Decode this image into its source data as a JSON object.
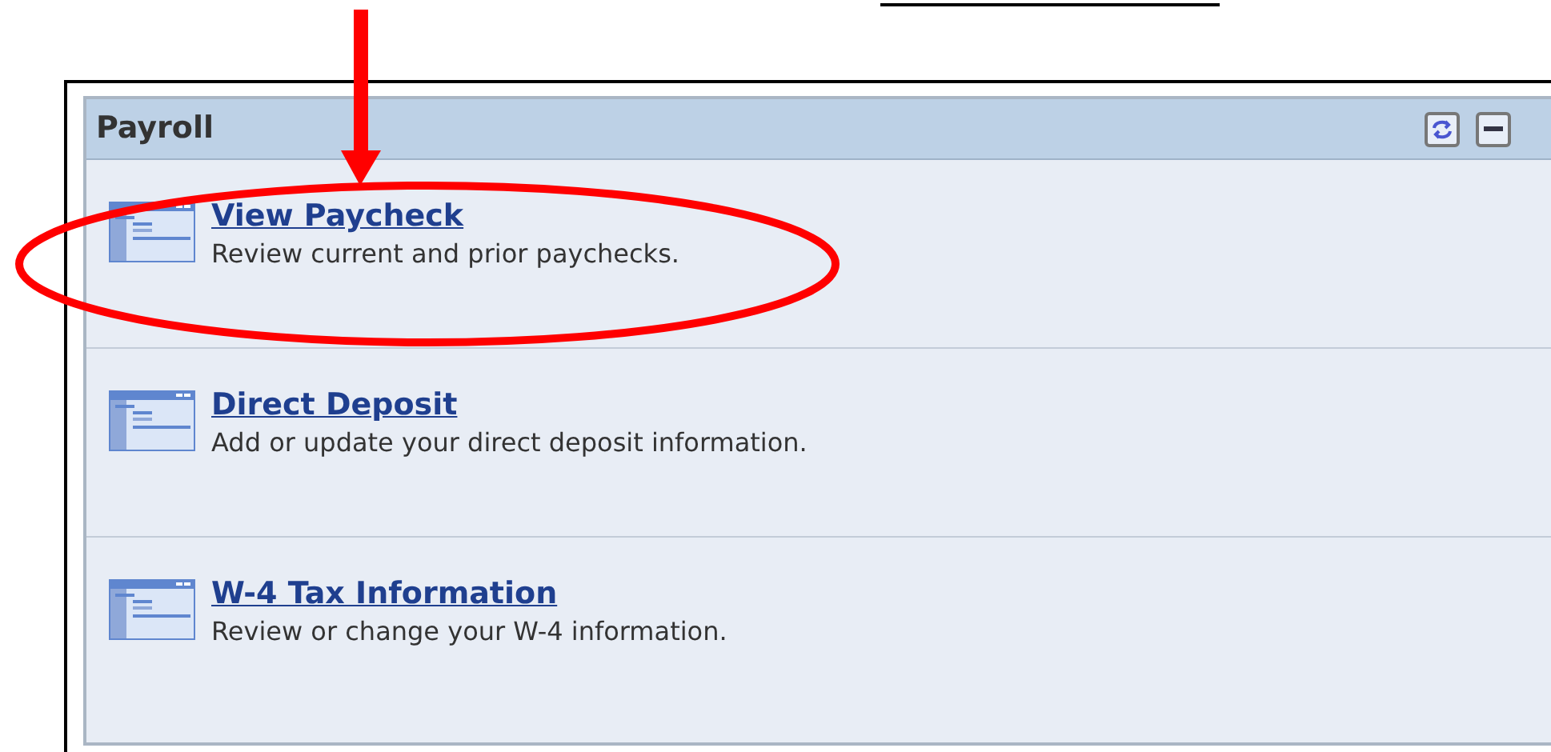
{
  "panel": {
    "title": "Payroll",
    "items": [
      {
        "title": "View Paycheck",
        "description": "Review current and prior paychecks."
      },
      {
        "title": "Direct Deposit",
        "description": "Add or update your direct deposit information."
      },
      {
        "title": "W-4 Tax Information",
        "description": "Review or change your W-4 information."
      }
    ]
  }
}
